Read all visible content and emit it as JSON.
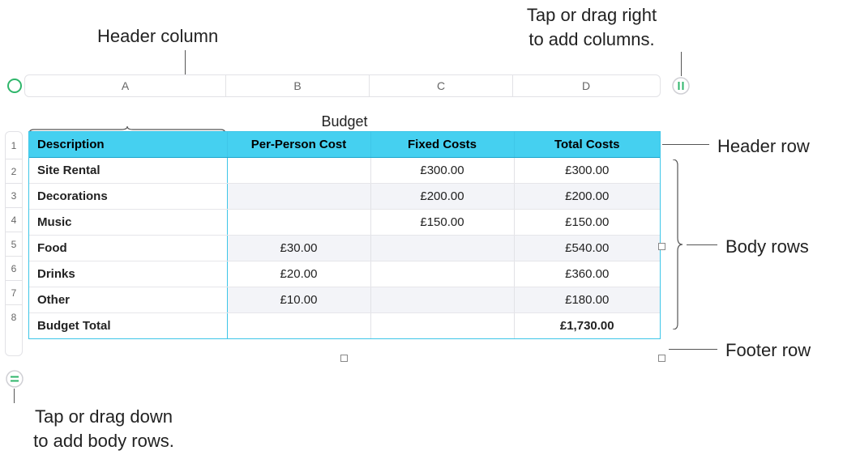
{
  "callouts": {
    "header_column": "Header column",
    "add_columns": "Tap or drag right\nto add columns.",
    "header_row": "Header row",
    "body_rows": "Body rows",
    "footer_row": "Footer row",
    "add_rows": "Tap or drag down\nto add body rows."
  },
  "column_letters": [
    "A",
    "B",
    "C",
    "D"
  ],
  "row_numbers": [
    "1",
    "2",
    "3",
    "4",
    "5",
    "6",
    "7",
    "8"
  ],
  "table": {
    "title": "Budget",
    "headers": [
      "Description",
      "Per-Person Cost",
      "Fixed Costs",
      "Total Costs"
    ],
    "rows": [
      {
        "desc": "Site Rental",
        "per": "",
        "fixed": "£300.00",
        "total": "£300.00"
      },
      {
        "desc": "Decorations",
        "per": "",
        "fixed": "£200.00",
        "total": "£200.00"
      },
      {
        "desc": "Music",
        "per": "",
        "fixed": "£150.00",
        "total": "£150.00"
      },
      {
        "desc": "Food",
        "per": "£30.00",
        "fixed": "",
        "total": "£540.00"
      },
      {
        "desc": "Drinks",
        "per": "£20.00",
        "fixed": "",
        "total": "£360.00"
      },
      {
        "desc": "Other",
        "per": "£10.00",
        "fixed": "",
        "total": "£180.00"
      }
    ],
    "footer": {
      "desc": "Budget Total",
      "per": "",
      "fixed": "",
      "total": "£1,730.00"
    }
  },
  "chart_data": {
    "type": "table",
    "title": "Budget",
    "columns": [
      "Description",
      "Per-Person Cost",
      "Fixed Costs",
      "Total Costs"
    ],
    "rows": [
      [
        "Site Rental",
        null,
        300.0,
        300.0
      ],
      [
        "Decorations",
        null,
        200.0,
        200.0
      ],
      [
        "Music",
        null,
        150.0,
        150.0
      ],
      [
        "Food",
        30.0,
        null,
        540.0
      ],
      [
        "Drinks",
        20.0,
        null,
        360.0
      ],
      [
        "Other",
        10.0,
        null,
        180.0
      ],
      [
        "Budget Total",
        null,
        null,
        1730.0
      ]
    ],
    "currency": "GBP"
  }
}
